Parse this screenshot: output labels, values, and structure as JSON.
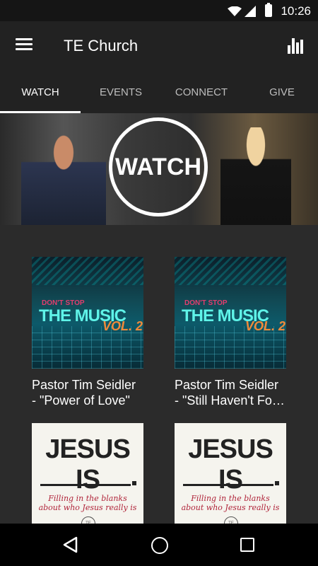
{
  "status_bar": {
    "time": "10:26"
  },
  "app_bar": {
    "title": "TE Church"
  },
  "tabs": [
    {
      "label": "WATCH",
      "active": true
    },
    {
      "label": "EVENTS",
      "active": false
    },
    {
      "label": "CONNECT",
      "active": false
    },
    {
      "label": "GIVE",
      "active": false
    }
  ],
  "banner": {
    "label": "WATCH"
  },
  "items": [
    {
      "title": "Pastor Tim Seidler\n- \"Power of Love\"",
      "art": {
        "small": "DON'T STOP",
        "big": "THE MUSIC",
        "vol": "VOL. 2"
      }
    },
    {
      "title": "Pastor Tim Seidler\n- \"Still Haven't Fo…",
      "art": {
        "small": "DON'T STOP",
        "big": "THE MUSIC",
        "vol": "VOL. 2"
      }
    },
    {
      "art": {
        "head": "JESUS IS",
        "script": "Filling in the blanks about who Jesus really is",
        "logo": "TE"
      }
    },
    {
      "art": {
        "head": "JESUS IS",
        "script": "Filling in the blanks about who Jesus really is",
        "logo": "TE"
      }
    }
  ],
  "icons": {
    "menu": "hamburger-icon",
    "stats": "bar-chart-icon",
    "back": "back-icon",
    "home": "home-icon",
    "recent": "recent-apps-icon"
  }
}
